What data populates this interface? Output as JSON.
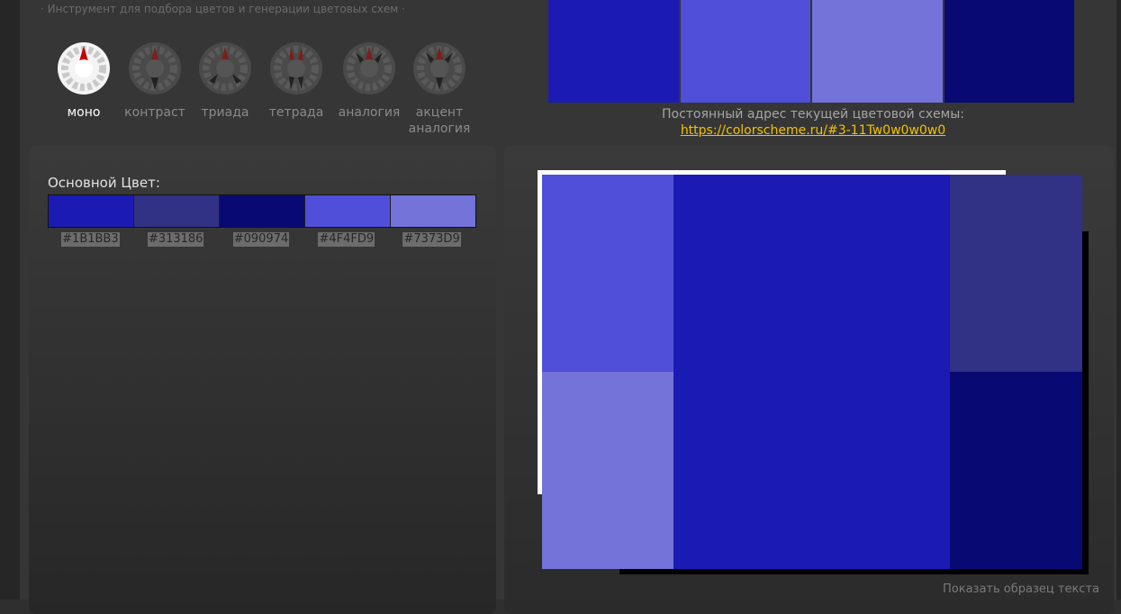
{
  "header": {
    "subtitle": "· Инструмент для подбора цветов и генерации цветовых схем ·"
  },
  "modes": [
    {
      "label": "моно",
      "active": true
    },
    {
      "label": "контраст",
      "active": false
    },
    {
      "label": "триада",
      "active": false
    },
    {
      "label": "тетрада",
      "active": false
    },
    {
      "label": "аналогия",
      "active": false
    },
    {
      "label": "акцент\nаналогия",
      "active": false
    }
  ],
  "top_swatches": [
    "#1B1BB3",
    "#4F4FD9",
    "#7373D9",
    "#090974"
  ],
  "permalink": {
    "label": "Постоянный адрес текущей цветовой схемы:",
    "url": "https://colorscheme.ru/#3-11Tw0w0w0w0"
  },
  "base_color": {
    "title": "Основной Цвет:",
    "swatches": [
      {
        "hex": "#1B1BB3",
        "color": "#1B1BB3"
      },
      {
        "hex": "#313186",
        "color": "#313186"
      },
      {
        "hex": "#090974",
        "color": "#090974"
      },
      {
        "hex": "#4F4FD9",
        "color": "#4F4FD9"
      },
      {
        "hex": "#7373D9",
        "color": "#7373D9"
      }
    ]
  },
  "preview_colors": {
    "top_left": "#4F4FD9",
    "bottom_left": "#7373D9",
    "center": "#1B1BB3",
    "top_right": "#313186",
    "bottom_right": "#090974"
  },
  "sample_text_link": "Показать образец текста"
}
